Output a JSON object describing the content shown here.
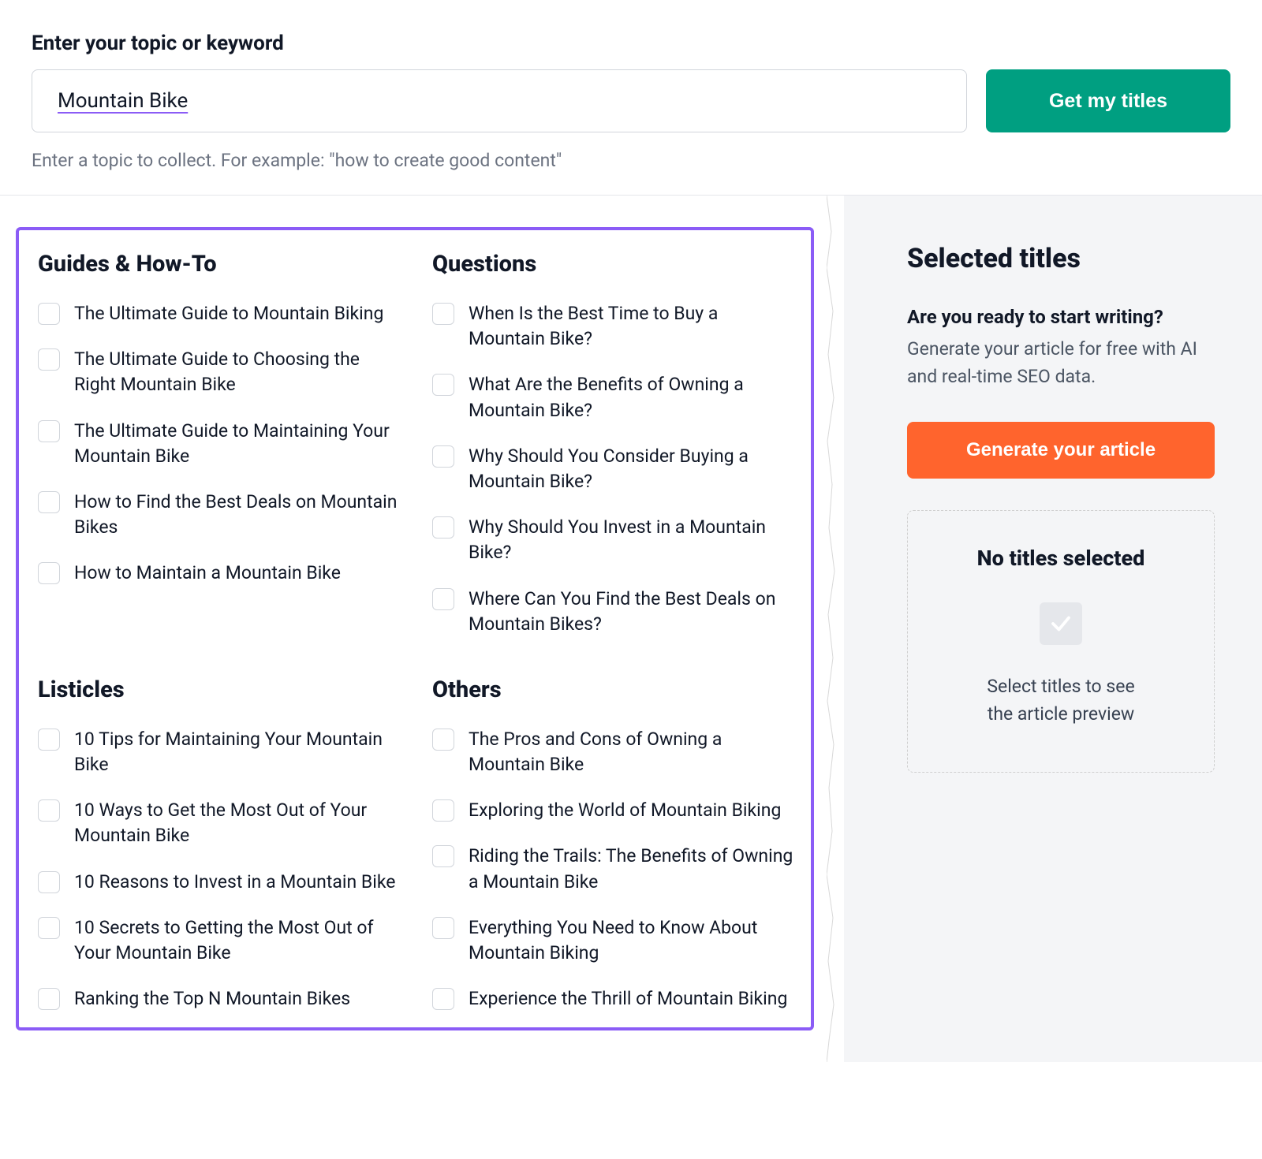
{
  "top": {
    "label": "Enter your topic or keyword",
    "input_value": "Mountain Bike",
    "button": "Get my titles",
    "helper_prefix": "Enter a topic to collect. For example: ",
    "helper_example": "\"how to create good content\""
  },
  "groups": {
    "guides": {
      "title": "Guides & How-To",
      "items": [
        "The Ultimate Guide to Mountain Biking",
        "The Ultimate Guide to Choosing the Right Mountain Bike",
        "The Ultimate Guide to Maintaining Your Mountain Bike",
        "How to Find the Best Deals on Mountain Bikes",
        "How to Maintain a Mountain Bike"
      ]
    },
    "questions": {
      "title": "Questions",
      "items": [
        "When Is the Best Time to Buy a Mountain Bike?",
        "What Are the Benefits of Owning a Mountain Bike?",
        "Why Should You Consider Buying a Mountain Bike?",
        "Why Should You Invest in a Mountain Bike?",
        "Where Can You Find the Best Deals on Mountain Bikes?"
      ]
    },
    "listicles": {
      "title": "Listicles",
      "items": [
        "10 Tips for Maintaining Your Mountain Bike",
        "10 Ways to Get the Most Out of Your Mountain Bike",
        "10 Reasons to Invest in a Mountain Bike",
        "10 Secrets to Getting the Most Out of Your Mountain Bike",
        "Ranking the Top N Mountain Bikes"
      ]
    },
    "others": {
      "title": "Others",
      "items": [
        "The Pros and Cons of Owning a Mountain Bike",
        "Exploring the World of Mountain Biking",
        "Riding the Trails: The Benefits of Owning a Mountain Bike",
        "Everything You Need to Know About Mountain Biking",
        "Experience the Thrill of Mountain Biking"
      ]
    }
  },
  "right": {
    "selected_title": "Selected titles",
    "ready_heading": "Are you ready to start writing?",
    "ready_sub": "Generate your article for free with AI and real-time SEO data.",
    "generate_button": "Generate your article",
    "no_selected_heading": "No titles selected",
    "no_selected_line1": "Select titles to see",
    "no_selected_line2": "the article preview"
  }
}
